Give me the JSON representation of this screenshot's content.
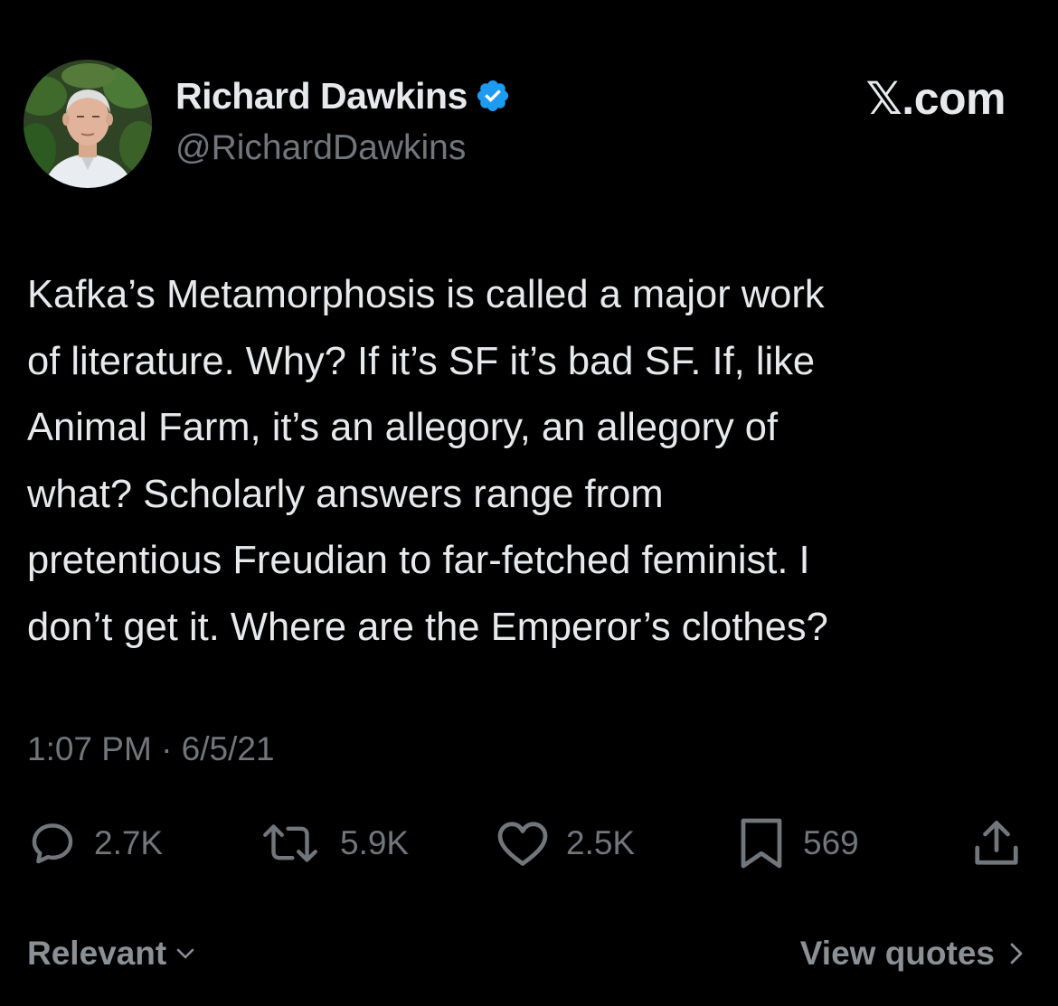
{
  "author": {
    "name": "Richard Dawkins",
    "handle": "@RichardDawkins",
    "verified": true,
    "avatar": "profile-photo"
  },
  "brand": "𝕏.com",
  "tweet": {
    "lines": [
      "Kafka’s Metamorphosis is called a major work",
      "of literature. Why? If it’s SF it’s bad SF. If, like",
      "Animal Farm, it’s an allegory, an allegory of",
      "what? Scholarly answers range from",
      "pretentious Freudian to far-fetched feminist. I",
      "don’t get it. Where are the Emperor’s clothes?"
    ],
    "timestamp": "1:07 PM · 6/5/21"
  },
  "actions": {
    "reply": {
      "icon": "reply-icon",
      "count": "2.7K"
    },
    "repost": {
      "icon": "repost-icon",
      "count": "5.9K"
    },
    "like": {
      "icon": "heart-icon",
      "count": "2.5K"
    },
    "bookmark": {
      "icon": "bookmark-icon",
      "count": "569"
    },
    "share": {
      "icon": "share-icon"
    }
  },
  "footer": {
    "sort_label": "Relevant",
    "view_quotes_label": "View quotes"
  },
  "colors": {
    "background": "#000000",
    "text_primary": "#e7e9ea",
    "text_secondary": "#71767b",
    "verified_badge": "#1d9bf0"
  }
}
